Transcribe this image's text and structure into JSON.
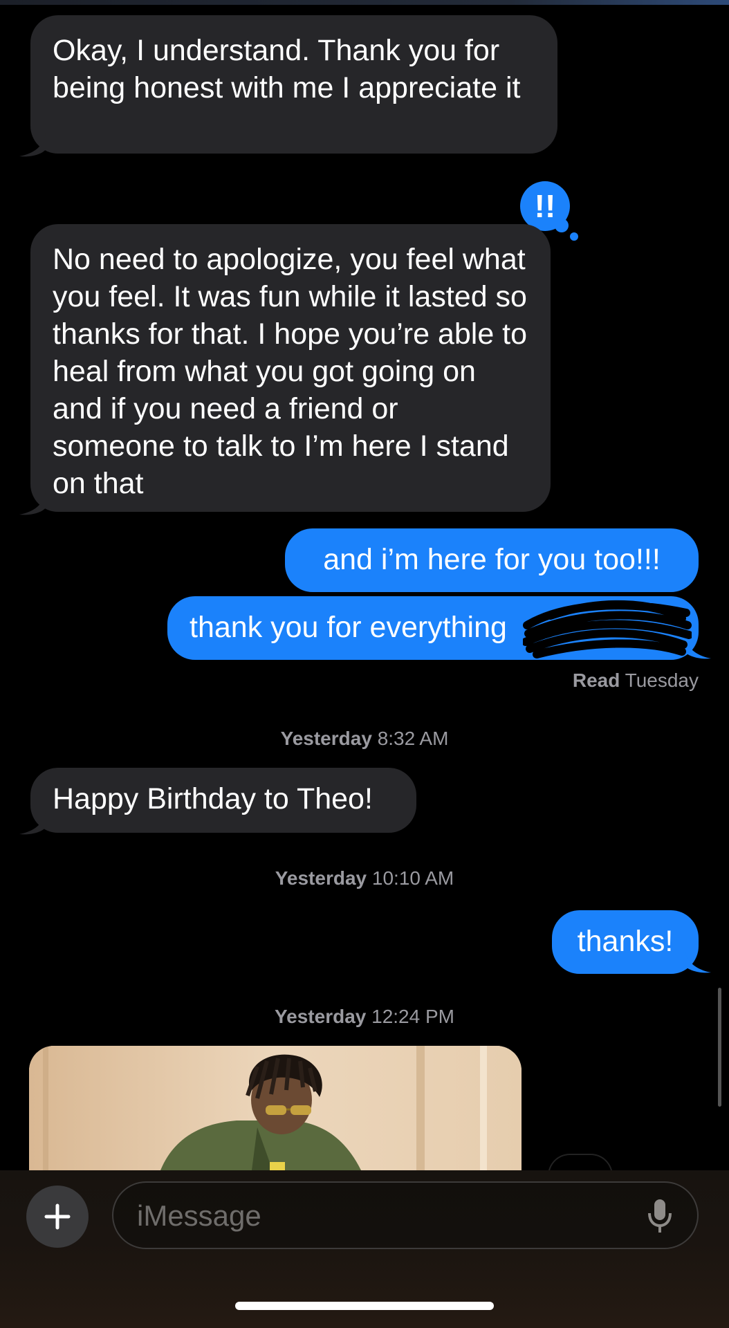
{
  "messages": [
    {
      "direction": "incoming",
      "text": "Okay, I understand. Thank you for being honest with me I appreciate it"
    },
    {
      "direction": "incoming",
      "text": "No need to apologize, you feel what you feel. It was fun while it lasted so thanks for that. I hope you’re able to heal from what you got going on and if you need a friend or someone to talk to I’m here I stand on that",
      "reaction": "!!"
    },
    {
      "direction": "outgoing",
      "text": "and i’m here for you too!!!"
    },
    {
      "direction": "outgoing",
      "text": "thank you for everything"
    },
    {
      "direction": "incoming",
      "text": "Happy Birthday to Theo!"
    },
    {
      "direction": "outgoing",
      "text": "thanks!"
    }
  ],
  "read_receipt": {
    "label": "Read",
    "day": "Tuesday"
  },
  "timestamps": [
    {
      "day": "Yesterday",
      "time": "8:32 AM"
    },
    {
      "day": "Yesterday",
      "time": "10:10 AM"
    },
    {
      "day": "Yesterday",
      "time": "12:24 PM"
    }
  ],
  "composer": {
    "placeholder": "iMessage"
  },
  "colors": {
    "outgoing": "#1b82fb",
    "incoming": "#262629",
    "background": "#000000"
  }
}
